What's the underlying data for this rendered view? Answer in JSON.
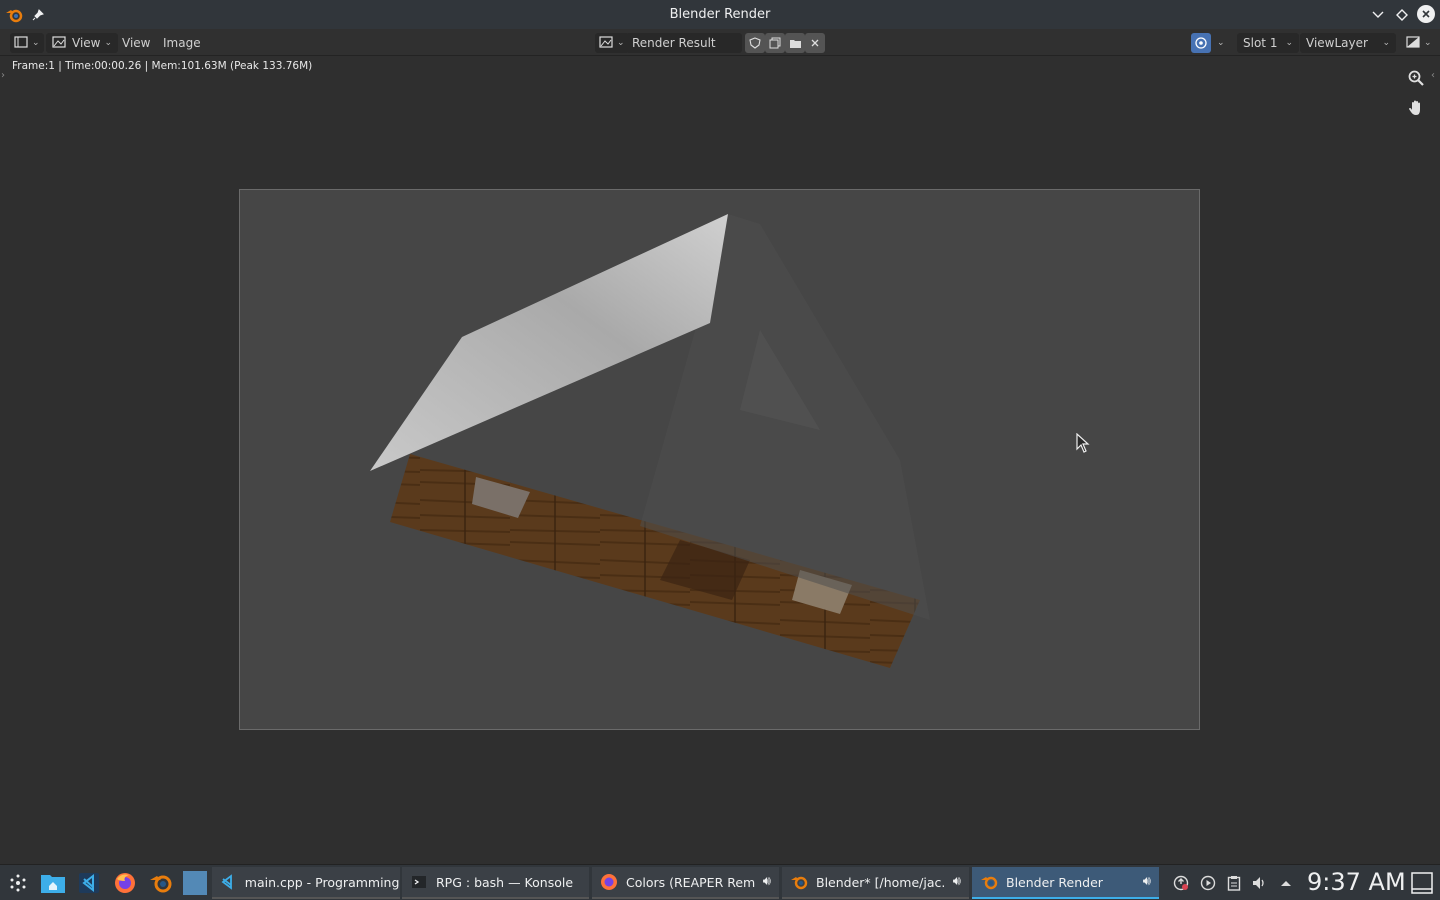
{
  "window": {
    "title": "Blender Render"
  },
  "header": {
    "view_menu_dropdown": "View",
    "menus": [
      "View",
      "Image"
    ],
    "image_name": "Render Result",
    "slot": "Slot 1",
    "view_layer": "ViewLayer"
  },
  "status": {
    "text": "Frame:1 | Time:00:00.26 | Mem:101.63M (Peak 133.76M)"
  },
  "taskbar": {
    "tasks": [
      {
        "label": "main.cpp - Programming...",
        "icon": "vscode-icon",
        "active": false,
        "audio": false
      },
      {
        "label": "RPG : bash — Konsole",
        "icon": "konsole-icon",
        "active": false,
        "audio": false
      },
      {
        "label": "Colors (REAPER Rem...",
        "icon": "firefox-icon",
        "active": false,
        "audio": true
      },
      {
        "label": "Blender* [/home/jac...",
        "icon": "blender-icon",
        "active": false,
        "audio": true
      },
      {
        "label": "Blender Render",
        "icon": "blender-icon",
        "active": true,
        "audio": true
      }
    ],
    "clock": "9:37 AM"
  },
  "colors": {
    "accent": "#3daee9",
    "blender_orange": "#e87d0d",
    "viewport_bg": "#2f2f2f",
    "render_bg": "#464646"
  }
}
